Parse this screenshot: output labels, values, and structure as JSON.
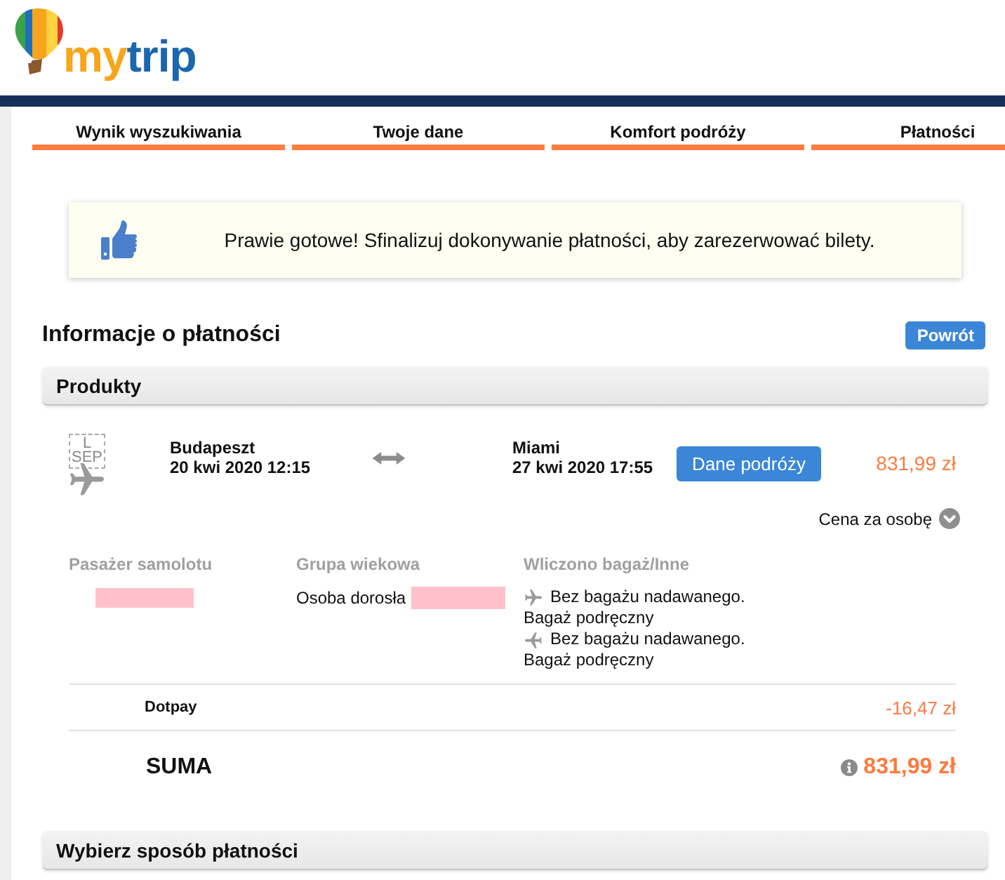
{
  "header": {
    "logo_text": [
      "my",
      "trip"
    ]
  },
  "steps": [
    {
      "label": "Wynik wyszukiwania"
    },
    {
      "label": "Twoje dane"
    },
    {
      "label": "Komfort podróży"
    },
    {
      "label": "Płatności"
    }
  ],
  "notice": {
    "text": "Prawie gotowe! Sfinalizuj dokonywanie płatności, aby zarezerwować bilety."
  },
  "payment_info": {
    "title": "Informacje o płatności",
    "back_button": "Powrót"
  },
  "products": {
    "title": "Produkty",
    "flight": {
      "airline_logo_alt": [
        "L",
        "SEP"
      ],
      "origin": {
        "city": "Budapeszt",
        "datetime": "20 kwi 2020 12:15"
      },
      "destination": {
        "city": "Miami",
        "datetime": "27 kwi 2020 17:55"
      },
      "details_button": "Dane podróży",
      "price": "831,99 zł"
    },
    "price_toggle": {
      "label": "Cena za osobę",
      "expanded": false
    },
    "passengers": {
      "columns": [
        "Pasażer samolotu",
        "Grupa wiekowa",
        "Wliczono bagaż/Inne"
      ],
      "rows": [
        {
          "name_redacted": true,
          "age_group": "Osoba dorosła",
          "age_detail_redacted": true,
          "baggage": [
            {
              "kind": "outbound",
              "lines": [
                "Bez bagażu nadawanego.",
                "Bagaż podręczny"
              ]
            },
            {
              "kind": "return",
              "lines": [
                "Bez bagażu nadawanego.",
                "Bagaż podręczny"
              ]
            }
          ]
        }
      ]
    },
    "fees": [
      {
        "label": "Dotpay",
        "amount": "-16,47 zł"
      }
    ],
    "total": {
      "label": "SUMA",
      "amount": "831,99 zł"
    }
  },
  "payment_method": {
    "title": "Wybierz sposób płatności"
  }
}
